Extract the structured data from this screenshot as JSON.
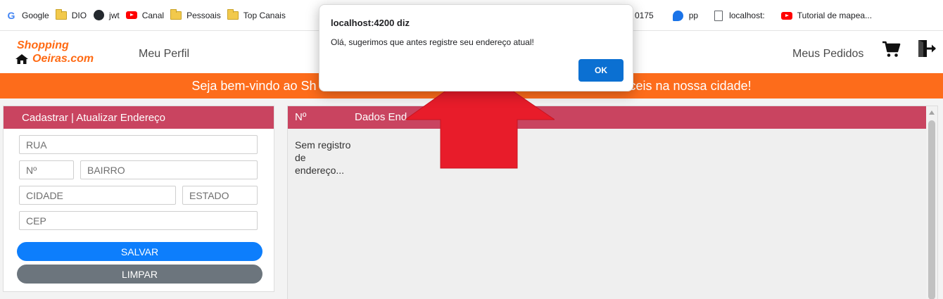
{
  "bookmarks": [
    {
      "label": "Google",
      "icon": "google-icon"
    },
    {
      "label": "DIO",
      "icon": "folder-icon"
    },
    {
      "label": "jwt",
      "icon": "github-icon"
    },
    {
      "label": "Canal",
      "icon": "youtube-icon"
    },
    {
      "label": "Pessoais",
      "icon": "folder-icon"
    },
    {
      "label": "Top Canais",
      "icon": "folder-icon"
    }
  ],
  "bookmarks_right": [
    {
      "label": "0175",
      "icon": ""
    },
    {
      "label": "pp",
      "icon": "pp-icon"
    },
    {
      "label": "localhost:",
      "icon": "document-icon"
    },
    {
      "label": "Tutorial de mapea...",
      "icon": "youtube-icon"
    }
  ],
  "navbar": {
    "logo_line1": "Shopping",
    "logo_line2": "Oeiras.com",
    "profile_link": "Meu Perfil",
    "orders_link": "Meus Pedidos"
  },
  "banner": {
    "left_text": "Seja bem-vindo ao Sh",
    "right_text": "ceis na nossa cidade!"
  },
  "form": {
    "title": "Cadastrar | Atualizar Endereço",
    "rua_placeholder": "RUA",
    "numero_placeholder": "Nº",
    "bairro_placeholder": "BAIRRO",
    "cidade_placeholder": "CIDADE",
    "estado_placeholder": "ESTADO",
    "cep_placeholder": "CEP",
    "save_label": "SALVAR",
    "clear_label": "LIMPAR"
  },
  "table": {
    "col_number": "Nº",
    "col_data": "Dados End",
    "empty_message": "Sem registro de endereço..."
  },
  "dialog": {
    "title": "localhost:4200 diz",
    "message": "Olá, sugerimos que antes registre seu endereço atual!",
    "ok_label": "OK"
  },
  "colors": {
    "accent_orange": "#fd6c1b",
    "header_red": "#c94460",
    "save_blue": "#0d7efc",
    "clear_gray": "#6c757d",
    "ok_blue": "#0b70d2",
    "arrow_red": "#e81c2a"
  }
}
